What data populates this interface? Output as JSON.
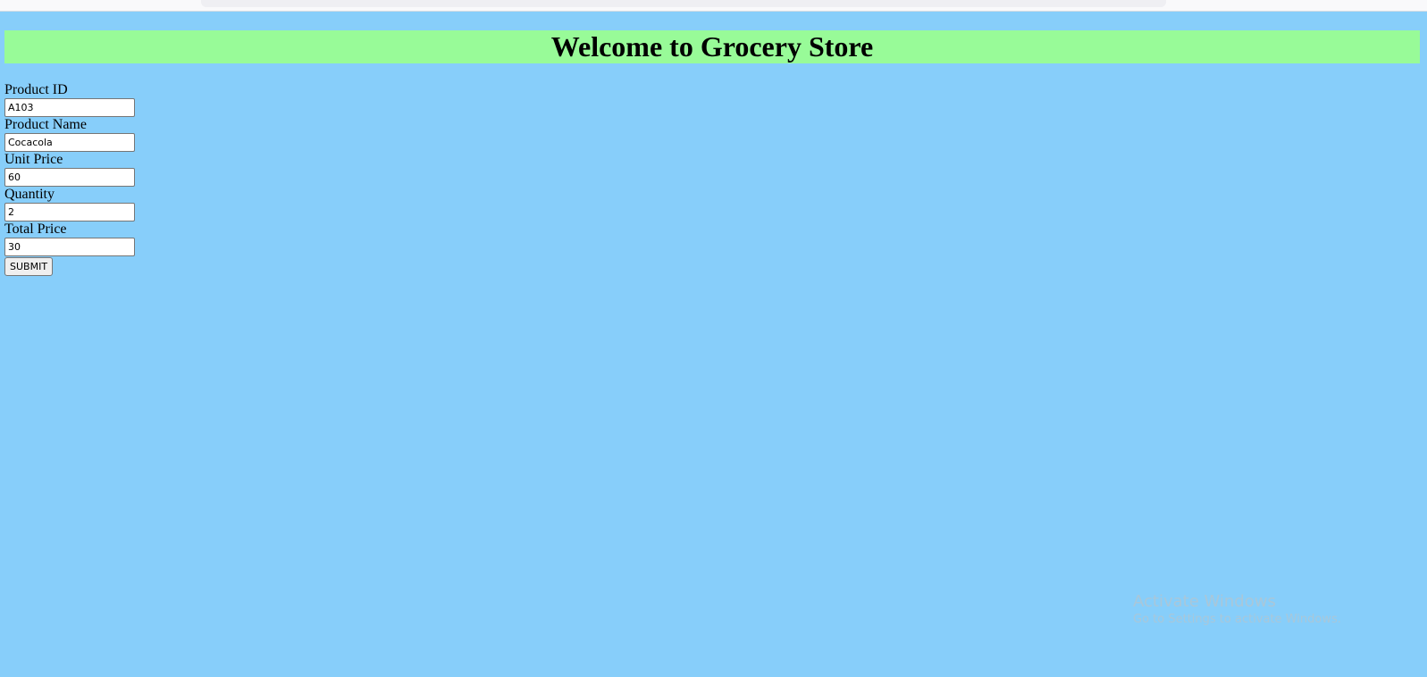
{
  "header": {
    "title": "Welcome to Grocery Store"
  },
  "form": {
    "fields": [
      {
        "label": "Product ID",
        "value": "A103"
      },
      {
        "label": "Product Name",
        "value": "Cocacola"
      },
      {
        "label": "Unit Price",
        "value": "60"
      },
      {
        "label": "Quantity",
        "value": "2"
      },
      {
        "label": "Total Price",
        "value": "30"
      }
    ],
    "submit_label": "SUBMIT"
  },
  "watermark": {
    "title": "Activate Windows",
    "subtitle": "Go to Settings to activate Windows."
  },
  "colors": {
    "background": "#87cefa",
    "header": "#98fb98"
  }
}
